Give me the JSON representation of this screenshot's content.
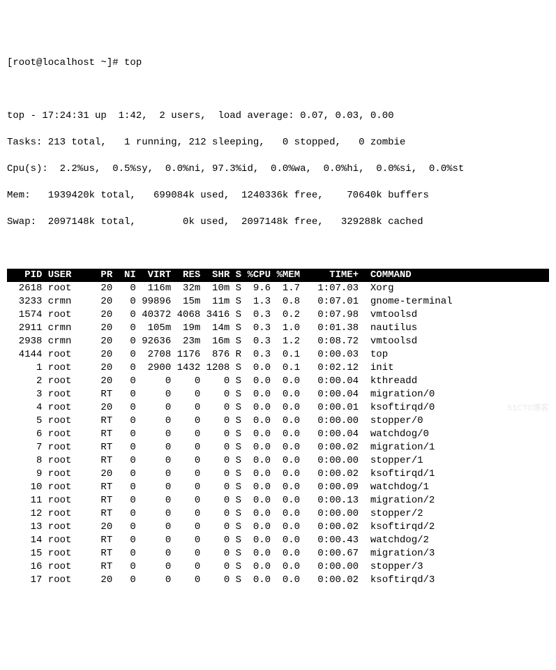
{
  "prompt": "[root@localhost ~]# top",
  "summary": {
    "line1": "top - 17:24:31 up  1:42,  2 users,  load average: 0.07, 0.03, 0.00",
    "line2": "Tasks: 213 total,   1 running, 212 sleeping,   0 stopped,   0 zombie",
    "line3": "Cpu(s):  2.2%us,  0.5%sy,  0.0%ni, 97.3%id,  0.0%wa,  0.0%hi,  0.0%si,  0.0%st",
    "line4": "Mem:   1939420k total,   699084k used,  1240336k free,    70640k buffers",
    "line5": "Swap:  2097148k total,        0k used,  2097148k free,   329288k cached"
  },
  "headers": [
    "PID",
    "USER",
    "PR",
    "NI",
    "VIRT",
    "RES",
    "SHR",
    "S",
    "%CPU",
    "%MEM",
    "TIME+",
    "COMMAND"
  ],
  "processes": [
    {
      "pid": "2618",
      "user": "root",
      "pr": "20",
      "ni": "0",
      "virt": "116m",
      "res": "32m",
      "shr": "10m",
      "s": "S",
      "cpu": "9.6",
      "mem": "1.7",
      "time": "1:07.03",
      "cmd": "Xorg"
    },
    {
      "pid": "3233",
      "user": "crmn",
      "pr": "20",
      "ni": "0",
      "virt": "99896",
      "res": "15m",
      "shr": "11m",
      "s": "S",
      "cpu": "1.3",
      "mem": "0.8",
      "time": "0:07.01",
      "cmd": "gnome-terminal"
    },
    {
      "pid": "1574",
      "user": "root",
      "pr": "20",
      "ni": "0",
      "virt": "40372",
      "res": "4068",
      "shr": "3416",
      "s": "S",
      "cpu": "0.3",
      "mem": "0.2",
      "time": "0:07.98",
      "cmd": "vmtoolsd"
    },
    {
      "pid": "2911",
      "user": "crmn",
      "pr": "20",
      "ni": "0",
      "virt": "105m",
      "res": "19m",
      "shr": "14m",
      "s": "S",
      "cpu": "0.3",
      "mem": "1.0",
      "time": "0:01.38",
      "cmd": "nautilus"
    },
    {
      "pid": "2938",
      "user": "crmn",
      "pr": "20",
      "ni": "0",
      "virt": "92636",
      "res": "23m",
      "shr": "16m",
      "s": "S",
      "cpu": "0.3",
      "mem": "1.2",
      "time": "0:08.72",
      "cmd": "vmtoolsd"
    },
    {
      "pid": "4144",
      "user": "root",
      "pr": "20",
      "ni": "0",
      "virt": "2708",
      "res": "1176",
      "shr": "876",
      "s": "R",
      "cpu": "0.3",
      "mem": "0.1",
      "time": "0:00.03",
      "cmd": "top"
    },
    {
      "pid": "1",
      "user": "root",
      "pr": "20",
      "ni": "0",
      "virt": "2900",
      "res": "1432",
      "shr": "1208",
      "s": "S",
      "cpu": "0.0",
      "mem": "0.1",
      "time": "0:02.12",
      "cmd": "init"
    },
    {
      "pid": "2",
      "user": "root",
      "pr": "20",
      "ni": "0",
      "virt": "0",
      "res": "0",
      "shr": "0",
      "s": "S",
      "cpu": "0.0",
      "mem": "0.0",
      "time": "0:00.04",
      "cmd": "kthreadd"
    },
    {
      "pid": "3",
      "user": "root",
      "pr": "RT",
      "ni": "0",
      "virt": "0",
      "res": "0",
      "shr": "0",
      "s": "S",
      "cpu": "0.0",
      "mem": "0.0",
      "time": "0:00.04",
      "cmd": "migration/0"
    },
    {
      "pid": "4",
      "user": "root",
      "pr": "20",
      "ni": "0",
      "virt": "0",
      "res": "0",
      "shr": "0",
      "s": "S",
      "cpu": "0.0",
      "mem": "0.0",
      "time": "0:00.01",
      "cmd": "ksoftirqd/0"
    },
    {
      "pid": "5",
      "user": "root",
      "pr": "RT",
      "ni": "0",
      "virt": "0",
      "res": "0",
      "shr": "0",
      "s": "S",
      "cpu": "0.0",
      "mem": "0.0",
      "time": "0:00.00",
      "cmd": "stopper/0"
    },
    {
      "pid": "6",
      "user": "root",
      "pr": "RT",
      "ni": "0",
      "virt": "0",
      "res": "0",
      "shr": "0",
      "s": "S",
      "cpu": "0.0",
      "mem": "0.0",
      "time": "0:00.04",
      "cmd": "watchdog/0"
    },
    {
      "pid": "7",
      "user": "root",
      "pr": "RT",
      "ni": "0",
      "virt": "0",
      "res": "0",
      "shr": "0",
      "s": "S",
      "cpu": "0.0",
      "mem": "0.0",
      "time": "0:00.02",
      "cmd": "migration/1"
    },
    {
      "pid": "8",
      "user": "root",
      "pr": "RT",
      "ni": "0",
      "virt": "0",
      "res": "0",
      "shr": "0",
      "s": "S",
      "cpu": "0.0",
      "mem": "0.0",
      "time": "0:00.00",
      "cmd": "stopper/1"
    },
    {
      "pid": "9",
      "user": "root",
      "pr": "20",
      "ni": "0",
      "virt": "0",
      "res": "0",
      "shr": "0",
      "s": "S",
      "cpu": "0.0",
      "mem": "0.0",
      "time": "0:00.02",
      "cmd": "ksoftirqd/1"
    },
    {
      "pid": "10",
      "user": "root",
      "pr": "RT",
      "ni": "0",
      "virt": "0",
      "res": "0",
      "shr": "0",
      "s": "S",
      "cpu": "0.0",
      "mem": "0.0",
      "time": "0:00.09",
      "cmd": "watchdog/1"
    },
    {
      "pid": "11",
      "user": "root",
      "pr": "RT",
      "ni": "0",
      "virt": "0",
      "res": "0",
      "shr": "0",
      "s": "S",
      "cpu": "0.0",
      "mem": "0.0",
      "time": "0:00.13",
      "cmd": "migration/2"
    },
    {
      "pid": "12",
      "user": "root",
      "pr": "RT",
      "ni": "0",
      "virt": "0",
      "res": "0",
      "shr": "0",
      "s": "S",
      "cpu": "0.0",
      "mem": "0.0",
      "time": "0:00.00",
      "cmd": "stopper/2"
    },
    {
      "pid": "13",
      "user": "root",
      "pr": "20",
      "ni": "0",
      "virt": "0",
      "res": "0",
      "shr": "0",
      "s": "S",
      "cpu": "0.0",
      "mem": "0.0",
      "time": "0:00.02",
      "cmd": "ksoftirqd/2"
    },
    {
      "pid": "14",
      "user": "root",
      "pr": "RT",
      "ni": "0",
      "virt": "0",
      "res": "0",
      "shr": "0",
      "s": "S",
      "cpu": "0.0",
      "mem": "0.0",
      "time": "0:00.43",
      "cmd": "watchdog/2"
    },
    {
      "pid": "15",
      "user": "root",
      "pr": "RT",
      "ni": "0",
      "virt": "0",
      "res": "0",
      "shr": "0",
      "s": "S",
      "cpu": "0.0",
      "mem": "0.0",
      "time": "0:00.67",
      "cmd": "migration/3"
    },
    {
      "pid": "16",
      "user": "root",
      "pr": "RT",
      "ni": "0",
      "virt": "0",
      "res": "0",
      "shr": "0",
      "s": "S",
      "cpu": "0.0",
      "mem": "0.0",
      "time": "0:00.00",
      "cmd": "stopper/3"
    },
    {
      "pid": "17",
      "user": "root",
      "pr": "20",
      "ni": "0",
      "virt": "0",
      "res": "0",
      "shr": "0",
      "s": "S",
      "cpu": "0.0",
      "mem": "0.0",
      "time": "0:00.02",
      "cmd": "ksoftirqd/3"
    }
  ],
  "watermark": "51CTO博客"
}
